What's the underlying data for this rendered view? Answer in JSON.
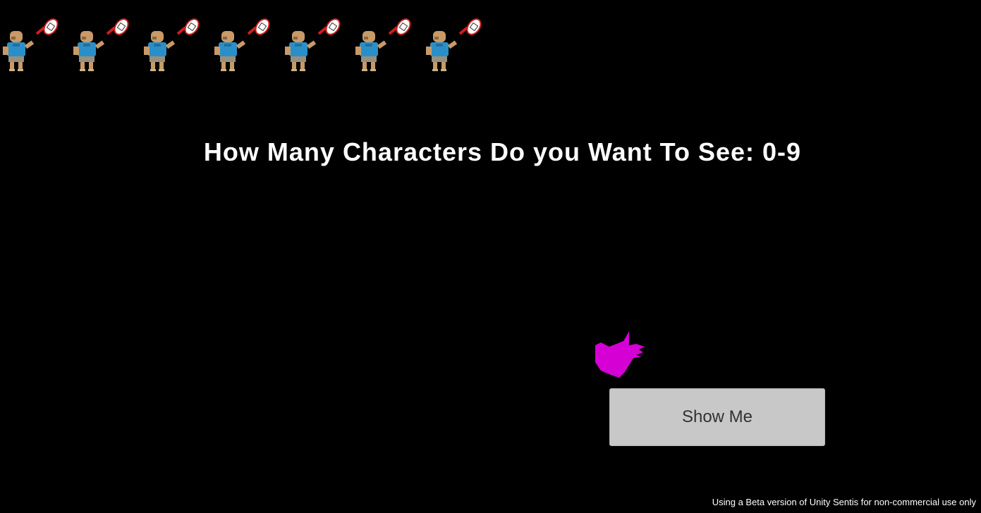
{
  "game": {
    "character_count": 7,
    "prompt_text": "How Many Characters Do you Want To See: 0-9",
    "show_button_label": "Show Me",
    "footer_note": "Using a Beta version of Unity Sentis for non-commercial use only"
  },
  "sprites": {
    "character_icon": "tennis-player-sprite",
    "drawing_icon": "magenta-stroke-shape"
  },
  "colors": {
    "background": "#000000",
    "prompt_text": "#ffffff",
    "button_background": "#c8c8c8",
    "button_text": "#323232",
    "drawing_fill": "#d400d4",
    "shirt": "#2a8fc8",
    "skin": "#c89a68",
    "racket_frame": "#cc1f1f"
  }
}
